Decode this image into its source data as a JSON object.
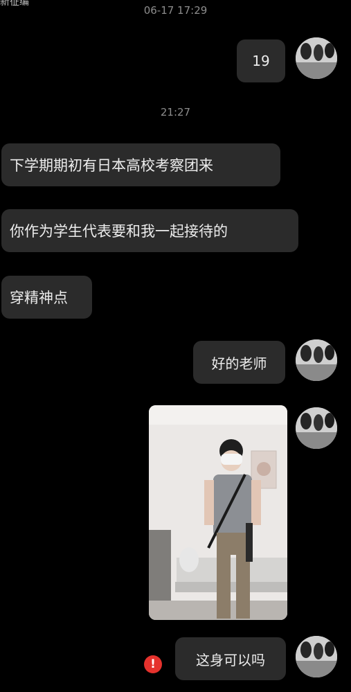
{
  "header": {
    "partial_label": "新征编",
    "timestamp_top": "06-17 17:29"
  },
  "messages": [
    {
      "side": "right",
      "text": "19"
    },
    {
      "time_separator": "21:27"
    },
    {
      "side": "left",
      "text": "下学期期初有日本高校考察团来"
    },
    {
      "side": "left",
      "text": "你作为学生代表要和我一起接待的"
    },
    {
      "side": "left",
      "text": "穿精神点"
    },
    {
      "side": "right",
      "text": "好的老师"
    },
    {
      "side": "right",
      "type": "image",
      "description_icon": "photo-image"
    },
    {
      "side": "right",
      "text": "这身可以吗",
      "status": "failed"
    }
  ],
  "icons": {
    "error": "!"
  }
}
